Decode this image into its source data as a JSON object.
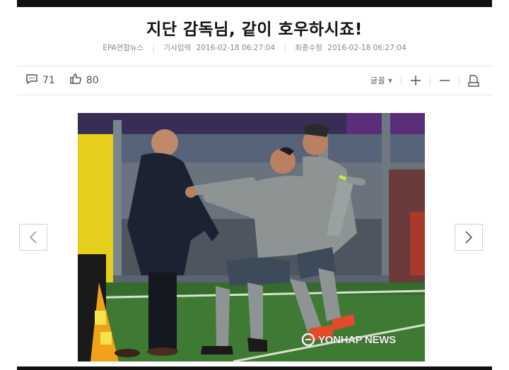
{
  "article": {
    "title": "지단 감독님, 같이 호우하시죠!",
    "meta": {
      "source": "EPA연합뉴스",
      "published_label": "기사입력",
      "published": "2016-02-18 06:27:04",
      "modified_label": "최종수정",
      "modified": "2016-02-18 06:27:04"
    }
  },
  "toolbar": {
    "comments_count": "71",
    "likes_count": "80",
    "font_label": "글꼴",
    "icons": {
      "comment": "comment-icon",
      "like": "thumbs-up-icon",
      "increase": "plus-icon",
      "decrease": "minus-icon",
      "print": "print-icon"
    }
  },
  "photo": {
    "watermark": "YONHAP NEWS",
    "prev_icon": "chevron-left-icon",
    "next_icon": "chevron-right-icon"
  },
  "colors": {
    "topbar": "#111111",
    "pitch": "#3f7a34",
    "kit": "#8e9494",
    "accent": "#c8e64a"
  }
}
